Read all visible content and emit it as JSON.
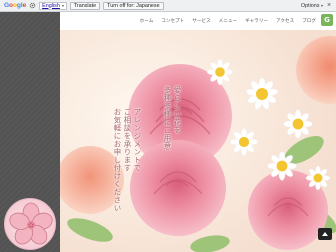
{
  "translate_bar": {
    "logo_text": "Google",
    "language_select": "English",
    "translate_button": "Translate",
    "turn_off_button": "Turn off for: Japanese",
    "options_label": "Options",
    "close_glyph": "×"
  },
  "nav": {
    "items": [
      "ホーム",
      "コンセプト",
      "サービス",
      "メニュー",
      "ギャラリー",
      "アクセス",
      "ブログ"
    ],
    "icon_glyph": "G"
  },
  "hero": {
    "lines": [
      "愛らしい花を",
      "多種多様にご用意",
      "アレンジメントで",
      "ご相談を承ります",
      "お気軽にお申し付けください"
    ]
  },
  "colors": {
    "left_panel": "#545454",
    "nav_icon": "#7ab55c",
    "hero_text": "#a86a74"
  },
  "icons": {
    "settings": "gear-icon",
    "close": "close-icon",
    "scroll_top": "chevron-up-icon",
    "logo": "flower-logo-icon"
  }
}
